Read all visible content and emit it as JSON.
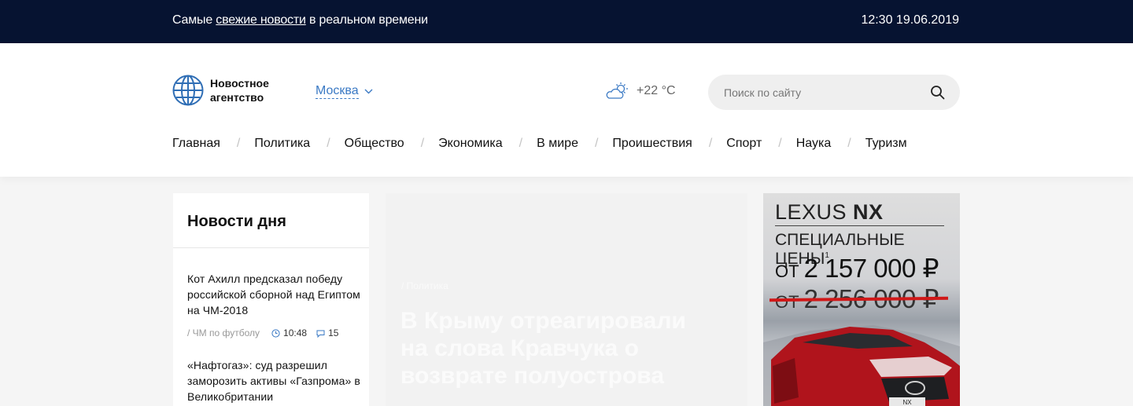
{
  "topbar": {
    "tagline_before": "Самые ",
    "tagline_link": "свежие новости",
    "tagline_after": " в реальном времени",
    "datetime": "12:30 19.06.2019"
  },
  "header": {
    "logo_text": "Новостное агентство",
    "city": "Москва",
    "weather": {
      "temp": "+22 °C",
      "icon": "partly-cloudy-icon"
    },
    "search": {
      "placeholder": "Поиск по сайту",
      "value": ""
    },
    "nav": [
      "Главная",
      "Политика",
      "Общество",
      "Экономика",
      "В мире",
      "Проишествия",
      "Спорт",
      "Наука",
      "Туризм"
    ]
  },
  "news_card": {
    "title": "Новости дня",
    "items": [
      {
        "headline": "Кот Ахилл предсказал победу российской сборной над Египтом на ЧМ-2018",
        "category": "/ ЧМ по футболу",
        "time": "10:48",
        "comments": "15"
      },
      {
        "headline": "«Нафтогаз»: суд разрешил заморозить активы «Газпрома» в Великобритании"
      }
    ]
  },
  "featured": {
    "rubric": "/ Политика",
    "title": "В Крыму отреагировали на слова Кравчука о возврате полуострова"
  },
  "ad": {
    "brand_light": "LEXUS ",
    "brand_bold": "NX",
    "special": "СПЕЦИАЛЬНЫЕ ЦЕНЫ",
    "footnote": "1",
    "from": "ОТ",
    "price_new": "2 157 000 ₽",
    "price_old": "2 256 000 ₽",
    "plate": "NX"
  },
  "colors": {
    "topbar_bg": "#061331",
    "accent": "#3a79c4",
    "strike": "#d01818",
    "car": "#b0141c"
  }
}
